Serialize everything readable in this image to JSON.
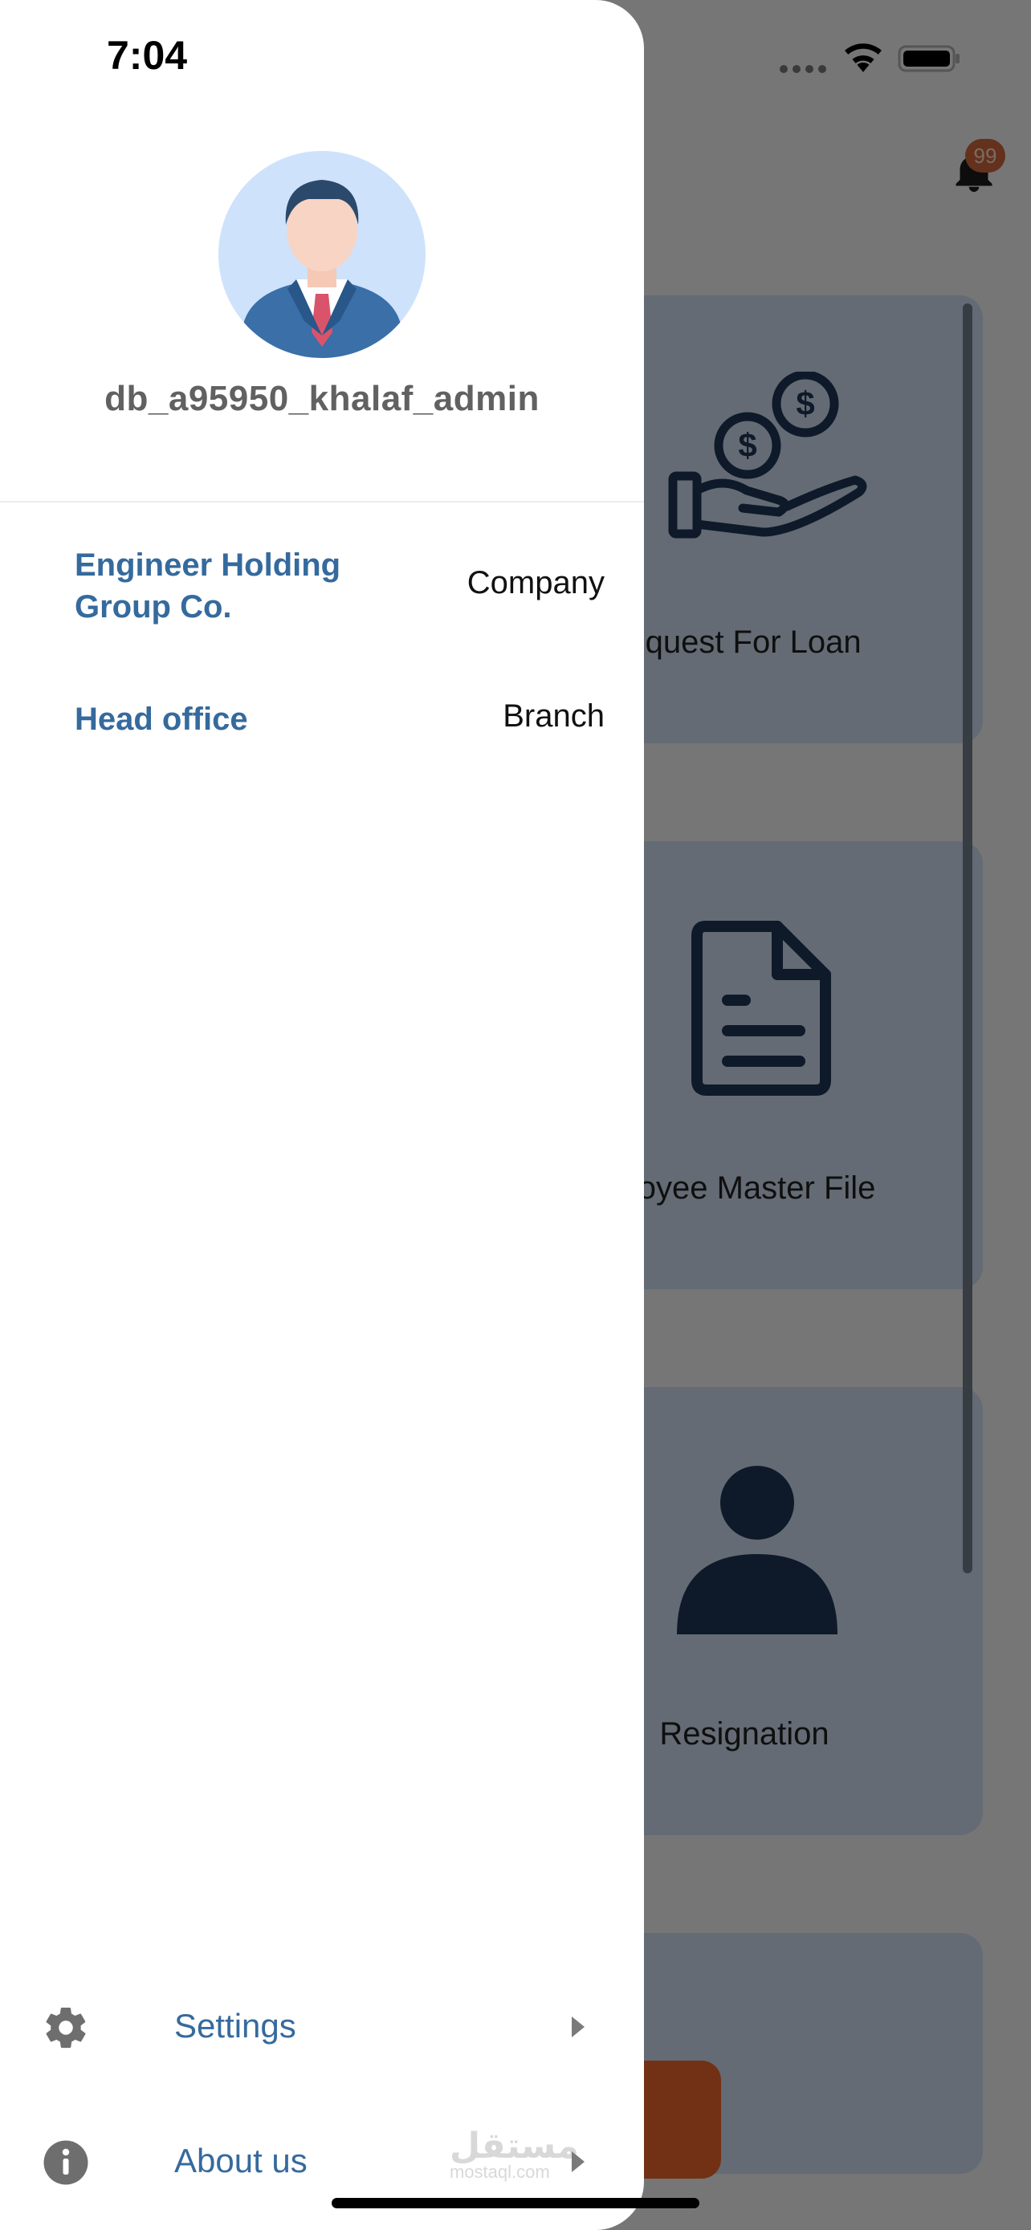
{
  "status_bar": {
    "time": "7:04"
  },
  "drawer": {
    "username": "db_a95950_khalaf_admin",
    "info": [
      {
        "key": "Company",
        "value": "Engineer Holding Group Co."
      },
      {
        "key": "Branch",
        "value": "Head office"
      }
    ],
    "menu": [
      {
        "label": "Settings",
        "icon": "gear-icon"
      },
      {
        "label": "About us",
        "icon": "info-icon"
      }
    ]
  },
  "background": {
    "notification_count": "99",
    "cards": [
      {
        "label": "equest For Loan",
        "icon": "loan-hand-coins-icon"
      },
      {
        "label": "ployee Master File",
        "icon": "document-icon"
      },
      {
        "label": "Resignation",
        "icon": "person-icon"
      }
    ]
  },
  "watermark": {
    "main": "مستقل",
    "sub": "mostaql.com"
  },
  "colors": {
    "accent": "#356a9d",
    "badge": "#c8623a",
    "action": "#e5632b",
    "overlay": "rgba(0,0,0,0.5)"
  }
}
